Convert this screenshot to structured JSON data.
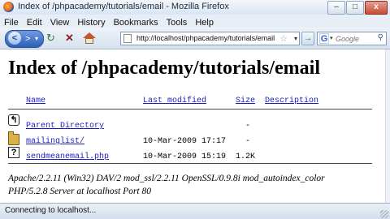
{
  "window": {
    "title": "Index of /phpacademy/tutorials/email - Mozilla Firefox",
    "buttons": {
      "minimize": "–",
      "maximize": "□",
      "close": "x"
    }
  },
  "menubar": {
    "items": [
      "File",
      "Edit",
      "View",
      "History",
      "Bookmarks",
      "Tools",
      "Help"
    ]
  },
  "toolbar": {
    "back_glyph": "<",
    "forward_glyph": ">",
    "dropdown_glyph": "▾",
    "refresh_glyph": "↻",
    "stop_glyph": "✕",
    "url": "http://localhost/phpacademy/tutorials/email",
    "go_glyph": "→",
    "search_placeholder": "Google",
    "search_engine_letter": "G"
  },
  "page": {
    "heading": "Index of /phpacademy/tutorials/email",
    "columns": {
      "name": "Name",
      "last_modified": "Last modified",
      "size": "Size",
      "description": "Description"
    },
    "rows": [
      {
        "icon": "back-icon",
        "glyph": "↰",
        "name": "Parent Directory",
        "modified": "",
        "size": "-",
        "description": ""
      },
      {
        "icon": "folder-icon",
        "glyph": "",
        "name": "mailinglist/",
        "modified": "10-Mar-2009 17:17",
        "size": "-",
        "description": ""
      },
      {
        "icon": "unknown-file-icon",
        "glyph": "?",
        "name": "sendmeanemail.php",
        "modified": "10-Mar-2009 15:19",
        "size": "1.2K",
        "description": ""
      }
    ],
    "address_line1": "Apache/2.2.11 (Win32) DAV/2 mod_ssl/2.2.11 OpenSSL/0.9.8i mod_autoindex_color",
    "address_line2": "PHP/5.2.8 Server at localhost Port 80"
  },
  "statusbar": {
    "text": "Connecting to localhost..."
  },
  "colors": {
    "link": "#1d1dbd",
    "titlebar_close": "#c84a34"
  }
}
